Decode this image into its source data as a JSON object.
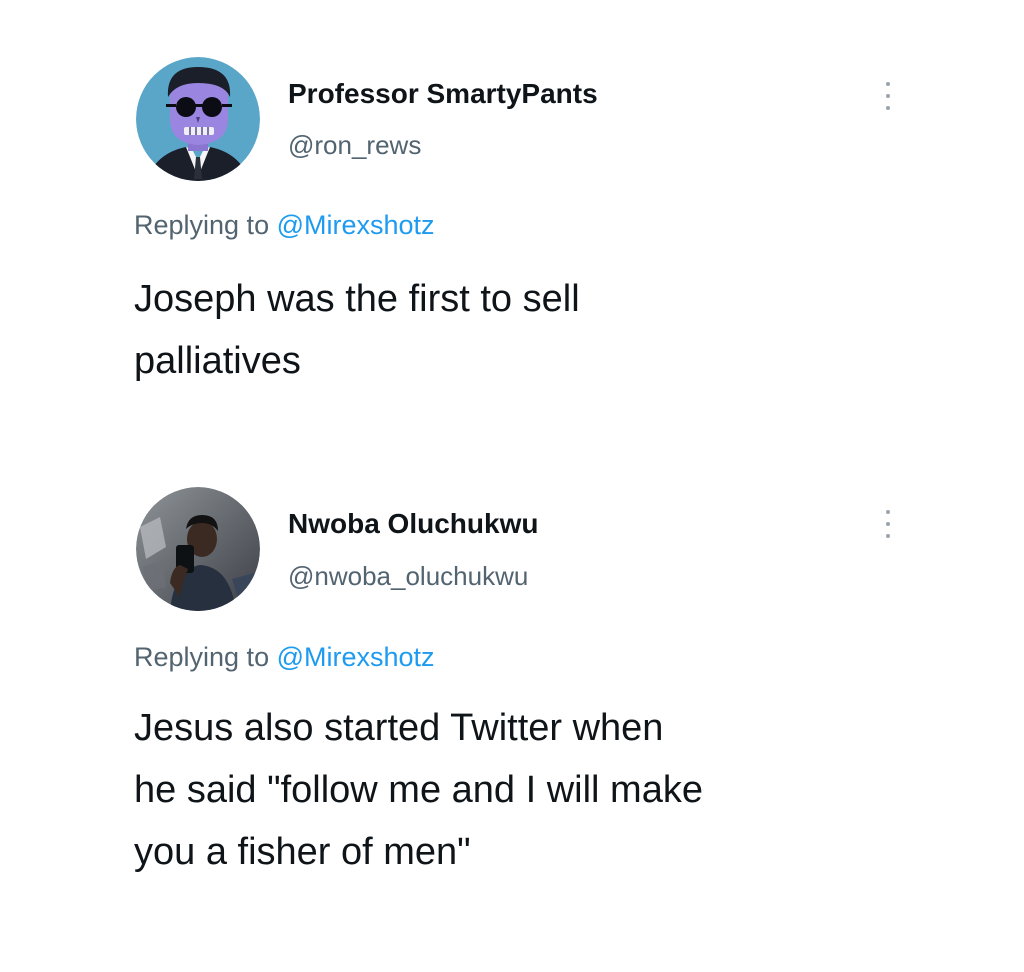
{
  "tweets": [
    {
      "display_name": "Professor SmartyPants",
      "handle": "@ron_rews",
      "avatar_icon": "cartoon-skull-avatar",
      "more_icon": "more-vertical-icon",
      "replying_prefix": "Replying to",
      "replying_to": "@Mirexshotz",
      "text_lines": [
        "Joseph was the first to sell",
        "palliatives"
      ]
    },
    {
      "display_name": "Nwoba Oluchukwu",
      "handle": "@nwoba_oluchukwu",
      "avatar_icon": "photo-avatar",
      "more_icon": "more-vertical-icon",
      "replying_prefix": "Replying to",
      "replying_to": "@Mirexshotz",
      "text_lines": [
        "Jesus also started Twitter when",
        "he said \"follow me and I will make",
        "you a fisher of men\""
      ]
    }
  ],
  "colors": {
    "name": "#0f1419",
    "secondary": "#536471",
    "mention": "#1d9bf0",
    "avatar1_bg": "#5aa6c8",
    "avatar1_face": "#9a86e0"
  }
}
